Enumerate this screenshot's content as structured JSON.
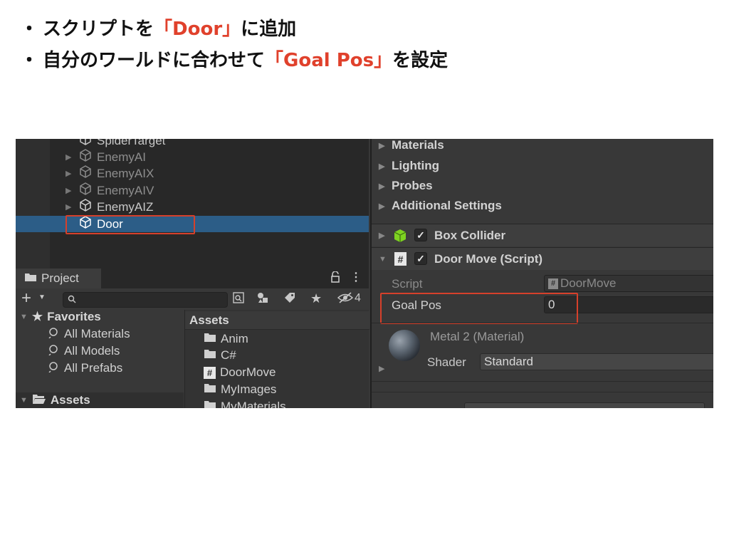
{
  "instructions": {
    "line1": {
      "bullet": "・",
      "before": "スクリプトを",
      "highlight": "「Door」",
      "after": "に追加"
    },
    "line2": {
      "bullet": "・",
      "before": "自分のワールドに合わせて",
      "highlight": "「Goal Pos」",
      "after": "を設定"
    },
    "highlight_color": "#e0412c"
  },
  "hierarchy": {
    "items": [
      {
        "label": "SpiderTarget",
        "dim": false,
        "partial": true
      },
      {
        "label": "EnemyAI",
        "dim": true
      },
      {
        "label": "EnemyAIX",
        "dim": true
      },
      {
        "label": "EnemyAIV",
        "dim": true
      },
      {
        "label": "EnemyAIZ",
        "dim": false
      },
      {
        "label": "Door",
        "selected": true
      }
    ],
    "selected_color": "#2c5d87"
  },
  "project": {
    "tab_label": "Project",
    "hidden_count": "4",
    "favorites_label": "Favorites",
    "favorites": [
      "All Materials",
      "All Models",
      "All Prefabs"
    ],
    "left_assets_label": "Assets",
    "assets_header": "Assets",
    "assets": [
      {
        "label": "Anim",
        "icon": "folder-icon"
      },
      {
        "label": "C#",
        "icon": "folder-icon"
      },
      {
        "label": "DoorMove",
        "icon": "script-icon"
      },
      {
        "label": "MyImages",
        "icon": "folder-icon"
      },
      {
        "label": "MyMaterials",
        "icon": "folder-icon",
        "partial": true
      }
    ]
  },
  "inspector": {
    "sections": [
      "Materials",
      "Lighting",
      "Probes",
      "Additional Settings"
    ],
    "box_collider": {
      "label": "Box Collider",
      "enabled": true
    },
    "door_move": {
      "label": "Door Move (Script)",
      "enabled": true,
      "script_label": "Script",
      "script_value": "DoorMove",
      "goal_pos_label": "Goal Pos",
      "goal_pos_value": "0"
    },
    "material": {
      "name": "Metal 2 (Material)",
      "shader_label": "Shader",
      "shader_value": "Standard"
    }
  },
  "annotation_color": "#d6402b"
}
